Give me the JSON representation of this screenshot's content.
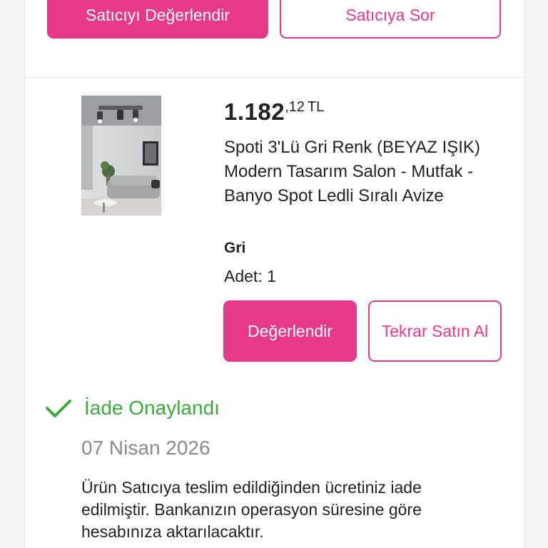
{
  "seller_actions": {
    "rate_seller_label": "Satıcıyı Değerlendir",
    "ask_seller_label": "Satıcıya Sor"
  },
  "product": {
    "price_integer": "1.182",
    "price_decimal": ",12",
    "price_currency": "TL",
    "title": "Spoti 3'Lü Gri Renk (BEYAZ IŞIK) Modern Tasarım Salon - Mutfak - Banyo Spot Ledli Sıralı Avize",
    "variant": "Gri",
    "quantity_label": "Adet:",
    "quantity_value": "1",
    "image_icon": "product-photo-living-room-ceiling-spot"
  },
  "product_actions": {
    "rate_label": "Değerlendir",
    "rebuy_label": "Tekrar Satın Al"
  },
  "refund": {
    "status_icon": "check-icon",
    "status_text": "İade Onaylandı",
    "date": "07 Nisan 2026",
    "description": "Ürün Satıcıya teslim edildiğinden ücretiniz iade edilmiştir. Bankanızın operasyon süresine göre hesabınıza aktarılacaktır."
  },
  "colors": {
    "accent": "#e8388a",
    "success": "#3cab3c",
    "muted_text": "#8a8a8a",
    "text": "#222222"
  }
}
